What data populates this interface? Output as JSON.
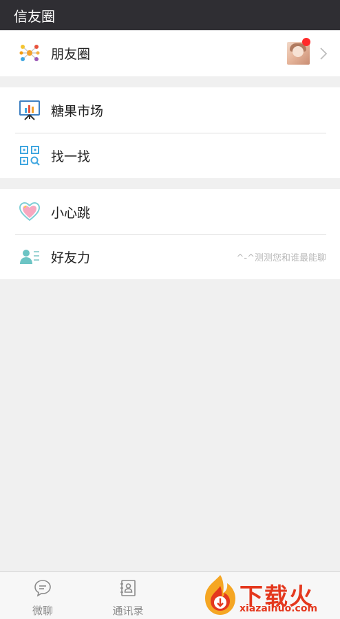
{
  "header": {
    "title": "信友圈"
  },
  "groups": [
    {
      "items": [
        {
          "label": "朋友圈"
        }
      ]
    },
    {
      "items": [
        {
          "label": "糖果市场"
        },
        {
          "label": "找一找"
        }
      ]
    },
    {
      "items": [
        {
          "label": "小心跳"
        },
        {
          "label": "好友力",
          "hint": "^-^测测您和谁最能聊"
        }
      ]
    }
  ],
  "tabbar": {
    "tabs": [
      {
        "label": "微聊"
      },
      {
        "label": "通讯录"
      }
    ]
  },
  "watermark": {
    "text": "下载火",
    "url": "xiazaihuo.com"
  },
  "colors": {
    "header_bg": "#2f2e33",
    "badge": "#ff2a2a",
    "watermark": "#e4381e"
  }
}
